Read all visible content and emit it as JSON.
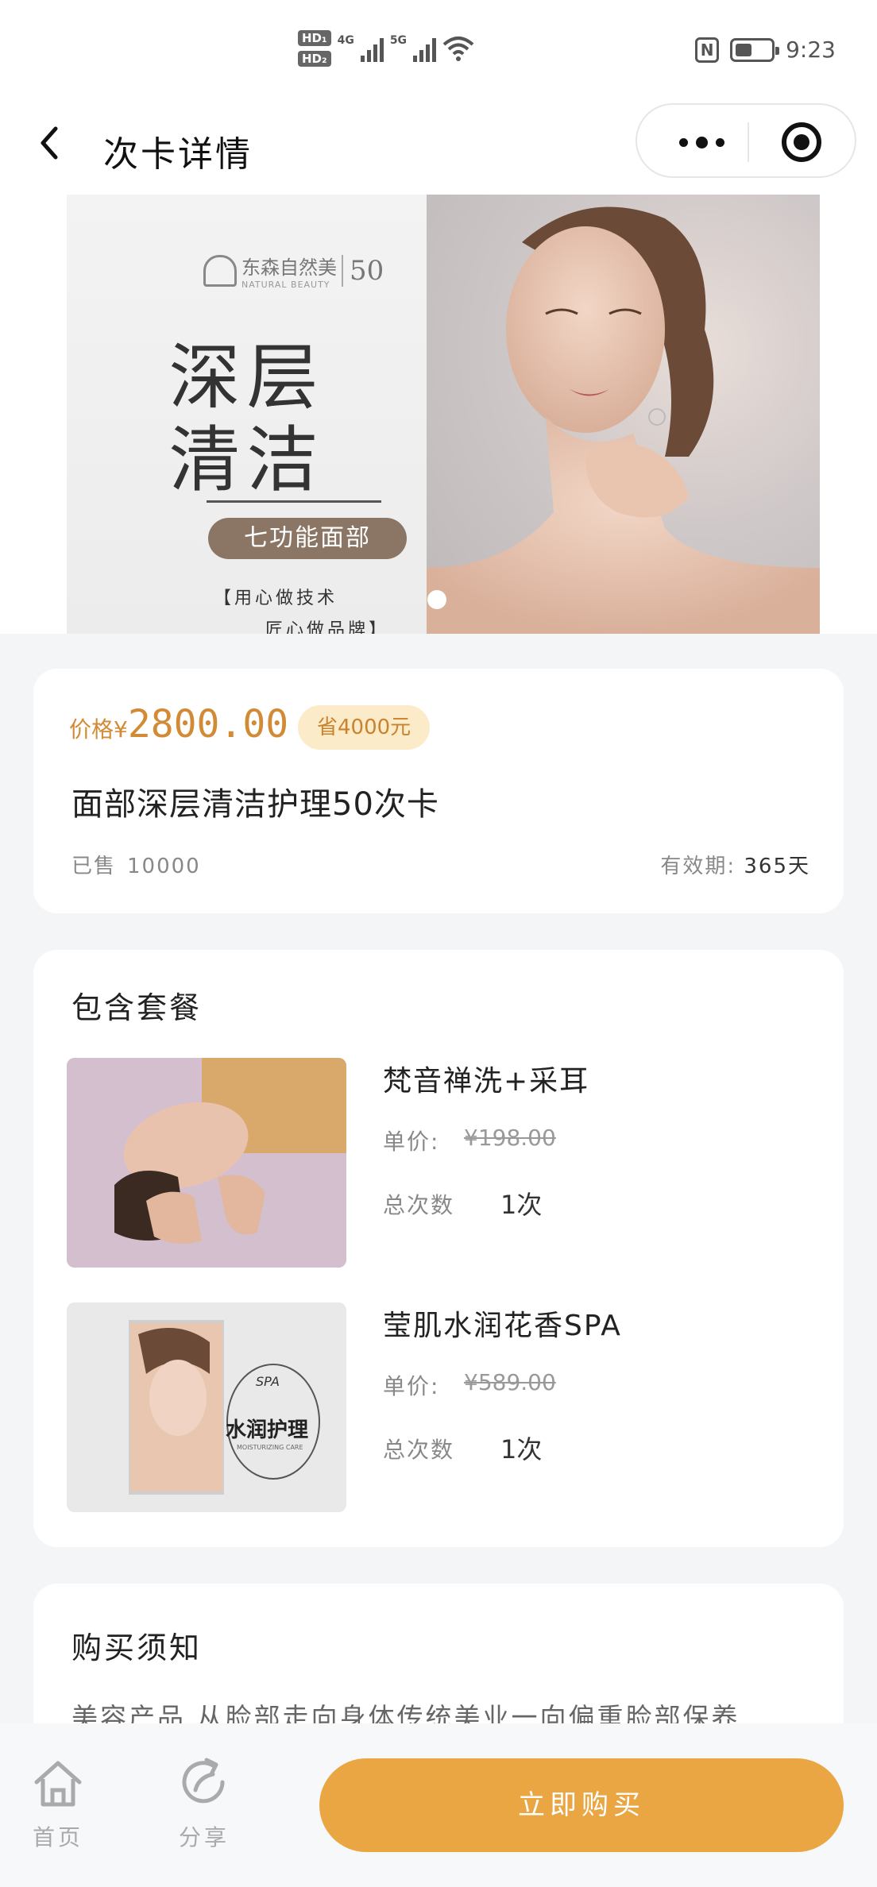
{
  "status_bar": {
    "hd1": "HD₁",
    "hd2": "HD₂",
    "net1": "4G",
    "net2": "5G",
    "nfc": "N",
    "time": "9:23"
  },
  "nav": {
    "title": "次卡详情"
  },
  "banner": {
    "brand_name": "东森自然美",
    "brand_sub": "NATURAL BEAUTY",
    "brand_num": "50",
    "headline_1": "深层",
    "headline_2": "清洁",
    "label": "七功能面部",
    "slogan_1": "【用心做技术",
    "slogan_2": "匠心做品牌】"
  },
  "product": {
    "price_prefix": "价格¥",
    "price": "2800.00",
    "save_badge": "省4000元",
    "title": "面部深层清洁护理50次卡",
    "sold_label": "已售",
    "sold_count": "10000",
    "validity_label": "有效期:",
    "validity_value": "365天"
  },
  "package": {
    "section_title": "包含套餐",
    "items": [
      {
        "name": "梵音禅洗+采耳",
        "price_label": "单价:",
        "price": "¥198.00",
        "count_label": "总次数",
        "count": "1次"
      },
      {
        "name": "莹肌水润花香SPA",
        "price_label": "单价:",
        "price": "¥589.00",
        "count_label": "总次数",
        "count": "1次",
        "thumb_text": "水润护理",
        "thumb_badge": "SPA",
        "thumb_sub": "MOISTURIZING CARE"
      }
    ]
  },
  "notice": {
    "section_title": "购买须知",
    "text": "美容产品,从脸部走向身体传统美业一向偏重脸部保养"
  },
  "bottom_bar": {
    "home_label": "首页",
    "share_label": "分享",
    "buy_label": "立即购买"
  },
  "colors": {
    "accent": "#e9a642",
    "price": "#d28a35",
    "badge_bg": "#fcebc8"
  }
}
